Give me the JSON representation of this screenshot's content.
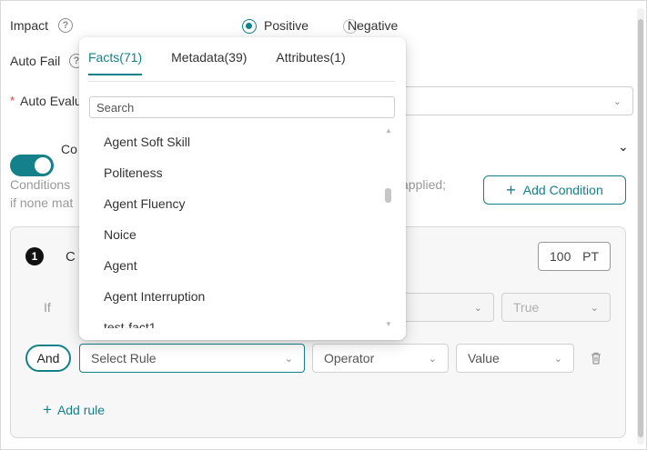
{
  "impact": {
    "label": "Impact",
    "options": [
      "Positive",
      "Negative"
    ],
    "selected": "Positive"
  },
  "auto_fail": {
    "label": "Auto Fail"
  },
  "auto_evaluate": {
    "label": "Auto Evalu",
    "required_mark": "*"
  },
  "conditional": {
    "toggle_label": "Co",
    "enabled": true
  },
  "conditions_text": {
    "line1_left": "Conditions",
    "line1_right": "applied;",
    "line2_left": "if none mat"
  },
  "add_condition": {
    "label": "Add Condition"
  },
  "condition_card": {
    "number": "1",
    "title_fragment": "C",
    "points_value": "100",
    "points_unit": "PT",
    "if_label": "If",
    "if_value": "True",
    "and_label": "And",
    "rule_placeholder": "Select Rule",
    "operator_placeholder": "Operator",
    "value_placeholder": "Value",
    "add_rule_label": "Add rule"
  },
  "dropdown": {
    "tabs": [
      {
        "label": "Facts(71)",
        "active": true
      },
      {
        "label": "Metadata(39)",
        "active": false
      },
      {
        "label": "Attributes(1)",
        "active": false
      }
    ],
    "search_placeholder": "Search",
    "options": [
      "Agent Soft Skill",
      "Politeness",
      "Agent Fluency",
      "Noice",
      "Agent",
      "Agent Interruption",
      "test-fact1"
    ]
  },
  "colors": {
    "accent": "#14808a",
    "border": "#d9d9d9"
  }
}
